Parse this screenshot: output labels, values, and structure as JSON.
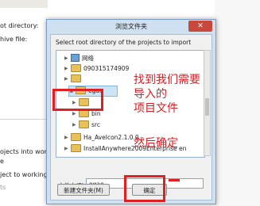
{
  "background_wizard": {
    "root_directory_label": "ot directory:",
    "archive_file_label": "hive file:",
    "option1": "ojects into works",
    "option2": "e",
    "option3": "ject to working",
    "option4": "ts"
  },
  "dialog": {
    "title": "浏览文件夹",
    "message": "Select root directory of the projects to import",
    "tree": [
      {
        "label": "网络",
        "icon": "network-icon"
      },
      {
        "label": "090315174909",
        "icon": "folder-icon"
      },
      {
        "label": "",
        "icon": "folder-icon"
      },
      {
        "label": "egao",
        "icon": "folder-icon",
        "selected": true
      },
      {
        "label": "",
        "icon": "folder-icon"
      },
      {
        "label": "bin",
        "icon": "folder-icon"
      },
      {
        "label": "src",
        "icon": "folder-icon"
      },
      {
        "label": "Ha_AveIcon2.1.0.0",
        "icon": "folder-icon"
      },
      {
        "label": "InstallAnywhere2009Enterprise en",
        "icon": "folder-icon"
      }
    ],
    "folder_label": "文件夹(F):",
    "folder_value": "egao",
    "new_folder_button": "新建文件夹(M)",
    "ok_button": "确定"
  },
  "annotations": {
    "instruction_line1": "找到我们需要",
    "instruction_line2": "导入的",
    "instruction_line3": "项目文件",
    "confirm_text": "然后确定",
    "color": "#d81f26"
  }
}
